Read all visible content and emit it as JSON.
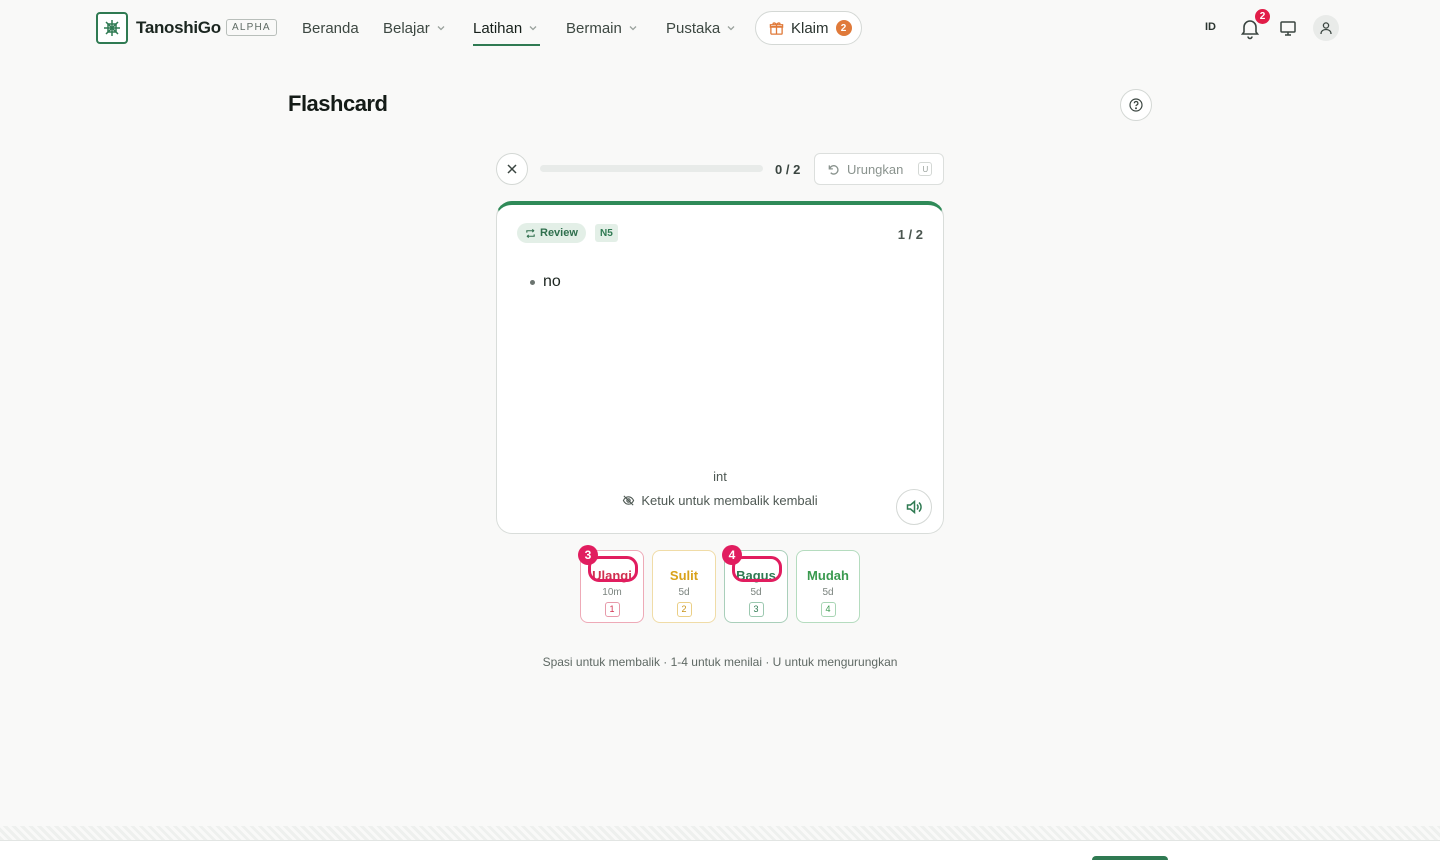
{
  "brand": {
    "name": "TanoshiGo",
    "badge": "ALPHA"
  },
  "nav": {
    "items": [
      {
        "label": "Beranda"
      },
      {
        "label": "Belajar"
      },
      {
        "label": "Latihan"
      },
      {
        "label": "Bermain"
      },
      {
        "label": "Pustaka"
      }
    ],
    "active": "Latihan",
    "klaim_label": "Klaim",
    "klaim_count": "2",
    "language": "ID",
    "notification_count": "2"
  },
  "page": {
    "title": "Flashcard"
  },
  "session": {
    "progress_text": "0 / 2",
    "progress_fraction": 0,
    "undo_label": "Urungkan",
    "undo_key": "U"
  },
  "card": {
    "tag": "Review",
    "level": "N5",
    "counter": "1 / 2",
    "meanings": [
      "no"
    ],
    "part_of_speech": "int",
    "flip_hint": "Ketuk untuk membalik kembali"
  },
  "ratings": [
    {
      "label": "Ulangi",
      "interval": "10m",
      "key": "1",
      "marker": "3"
    },
    {
      "label": "Sulit",
      "interval": "5d",
      "key": "2"
    },
    {
      "label": "Bagus",
      "interval": "5d",
      "key": "3",
      "marker": "4"
    },
    {
      "label": "Mudah",
      "interval": "5d",
      "key": "4"
    }
  ],
  "shortcuts_hint": "Spasi untuk membalik · 1-4 untuk menilai · U untuk mengurungkan",
  "colors": {
    "accent": "#2f7a52",
    "again": "#d0304f",
    "hard": "#d9a21a",
    "good": "#2f7a52",
    "easy": "#3a9a4f",
    "marker": "#e11d5f"
  }
}
